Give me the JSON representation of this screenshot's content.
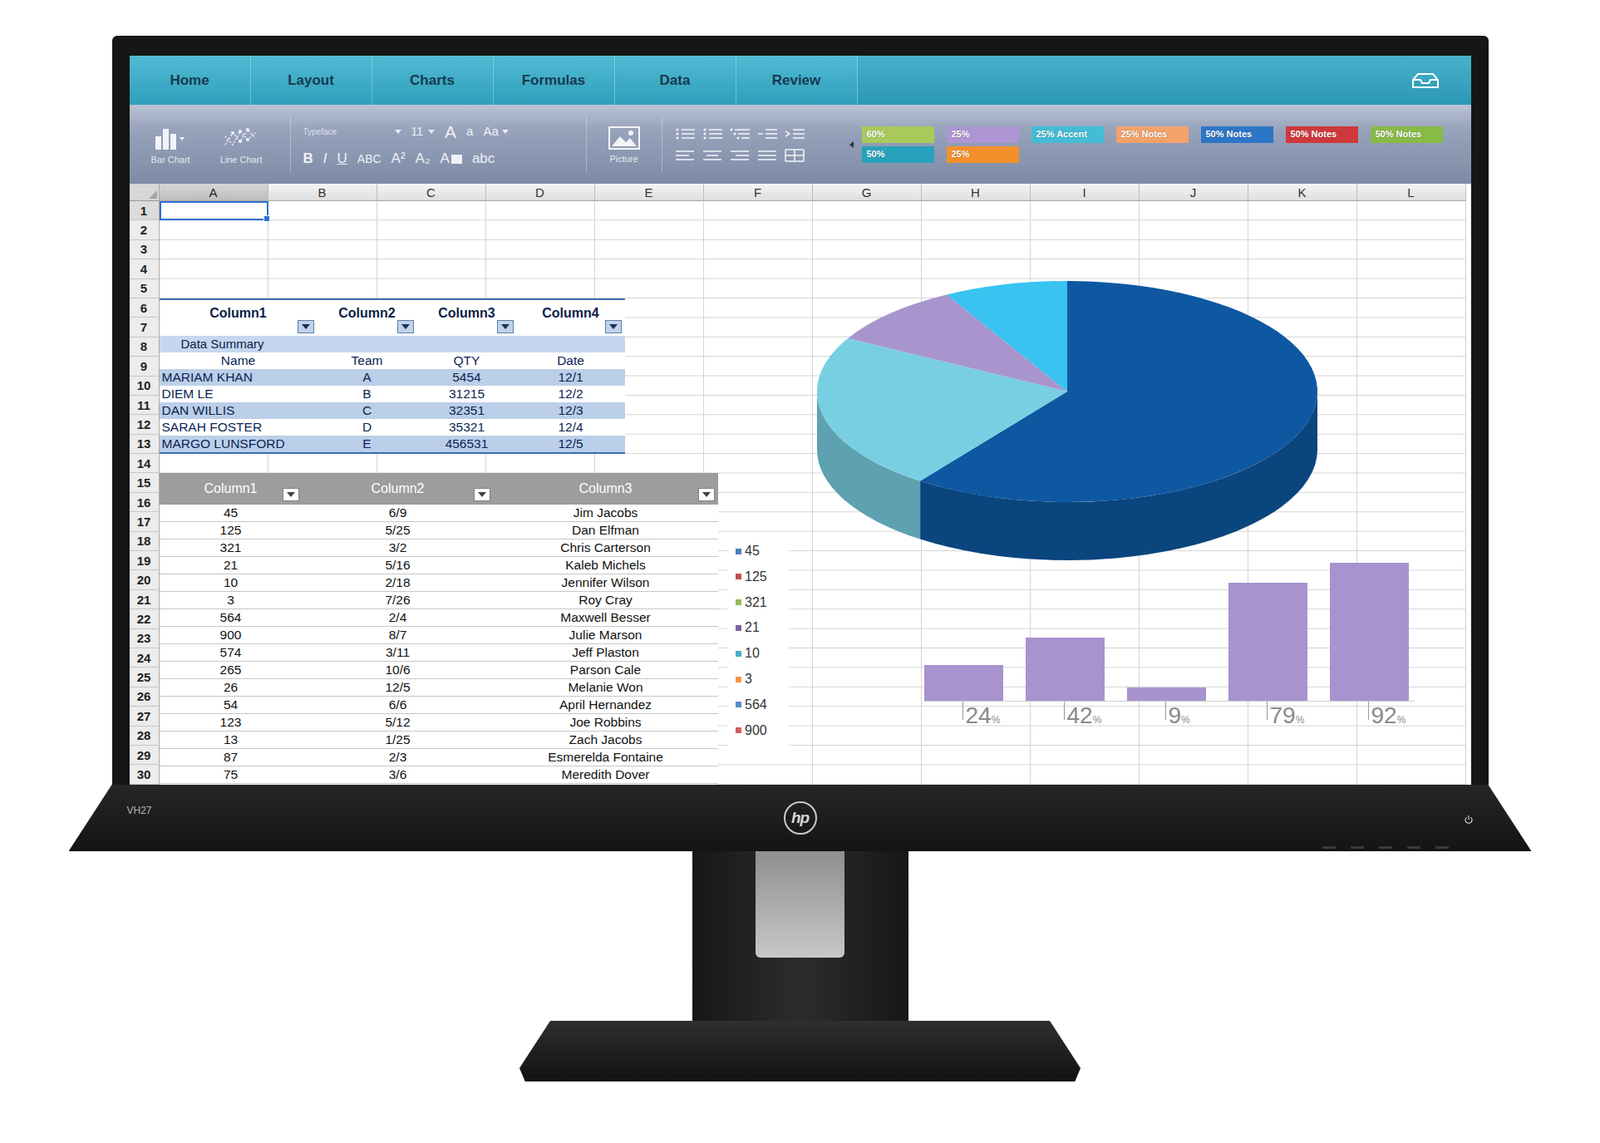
{
  "monitor": {
    "model": "VH27",
    "logo": "hp"
  },
  "ribbon": {
    "tabs": [
      {
        "label": "Home",
        "selected": false
      },
      {
        "label": "Layout",
        "selected": false
      },
      {
        "label": "Charts",
        "selected": false
      },
      {
        "label": "Formulas",
        "selected": false
      },
      {
        "label": "Data",
        "selected": false
      },
      {
        "label": "Review",
        "selected": false
      }
    ]
  },
  "toolbar": {
    "chart_buttons": [
      {
        "label": "Bar Chart",
        "kind": "bar"
      },
      {
        "label": "Line Chart",
        "kind": "line"
      }
    ],
    "typeface": "Typeface",
    "font_size": "11",
    "grow": "A",
    "shrink": "a",
    "change_case": "Aa",
    "format_buttons": [
      "B",
      "I",
      "U",
      "ABC",
      "A²",
      "A₂"
    ],
    "highlight": "A",
    "text_effects": "abc",
    "picture": "Picture",
    "style_rows": [
      [
        {
          "label": "60%",
          "color": "#a9c95c"
        },
        {
          "label": "25%",
          "color": "#ad96d3"
        },
        {
          "label": "25% Accent",
          "color": "#43bdd5"
        },
        {
          "label": "25% Notes",
          "color": "#f3a26b"
        },
        {
          "label": "50% Notes",
          "color": "#2b76c7"
        },
        {
          "label": "50% Notes",
          "color": "#cf383b"
        },
        {
          "label": "50% Notes",
          "color": "#88bb45"
        }
      ],
      [
        {
          "label": "50%",
          "color": "#28a2bc"
        },
        {
          "label": "25%",
          "color": "#f3902c"
        }
      ]
    ]
  },
  "sheet": {
    "columns": [
      {
        "label": "A",
        "selected": true
      },
      {
        "label": "B",
        "selected": false
      },
      {
        "label": "C",
        "selected": false
      },
      {
        "label": "D",
        "selected": false
      },
      {
        "label": "E",
        "selected": false
      },
      {
        "label": "F",
        "selected": false
      },
      {
        "label": "G",
        "selected": false
      },
      {
        "label": "H",
        "selected": false
      },
      {
        "label": "I",
        "selected": false
      },
      {
        "label": "J",
        "selected": false
      },
      {
        "label": "K",
        "selected": false
      },
      {
        "label": "L",
        "selected": false
      }
    ],
    "rows": [
      {
        "label": "1",
        "selected": true
      },
      {
        "label": "2",
        "selected": false
      },
      {
        "label": "3",
        "selected": false
      },
      {
        "label": "4",
        "selected": false
      },
      {
        "label": "5",
        "selected": false
      },
      {
        "label": "6",
        "selected": false
      },
      {
        "label": "7",
        "selected": false
      },
      {
        "label": "8",
        "selected": false
      },
      {
        "label": "9",
        "selected": false
      },
      {
        "label": "10",
        "selected": false
      },
      {
        "label": "11",
        "selected": false
      },
      {
        "label": "12",
        "selected": false
      },
      {
        "label": "13",
        "selected": false
      },
      {
        "label": "14",
        "selected": false
      },
      {
        "label": "15",
        "selected": false
      },
      {
        "label": "16",
        "selected": false
      },
      {
        "label": "17",
        "selected": false
      },
      {
        "label": "18",
        "selected": false
      },
      {
        "label": "19",
        "selected": false
      },
      {
        "label": "20",
        "selected": false
      },
      {
        "label": "21",
        "selected": false
      },
      {
        "label": "22",
        "selected": false
      },
      {
        "label": "23",
        "selected": false
      },
      {
        "label": "24",
        "selected": false
      },
      {
        "label": "25",
        "selected": false
      },
      {
        "label": "26",
        "selected": false
      },
      {
        "label": "27",
        "selected": false
      },
      {
        "label": "28",
        "selected": false
      },
      {
        "label": "29",
        "selected": false
      },
      {
        "label": "30",
        "selected": false
      }
    ]
  },
  "summary_table": {
    "columns": [
      "Column1",
      "Column2",
      "Column3",
      "Column4"
    ],
    "caption": "Data Summary",
    "fields": [
      "Name",
      "Team",
      "QTY",
      "Date"
    ],
    "rows": [
      [
        "MARIAM KHAN",
        "A",
        "5454",
        "12/1"
      ],
      [
        "DIEM LE",
        "B",
        "31215",
        "12/2"
      ],
      [
        "DAN WILLIS",
        "C",
        "32351",
        "12/3"
      ],
      [
        "SARAH FOSTER",
        "D",
        "35321",
        "12/4"
      ],
      [
        "MARGO LUNSFORD",
        "E",
        "456531",
        "12/5"
      ]
    ]
  },
  "list_table": {
    "columns": [
      "Column1",
      "Column2",
      "Column3"
    ],
    "rows": [
      [
        "45",
        "6/9",
        "Jim Jacobs"
      ],
      [
        "125",
        "5/25",
        "Dan Elfman"
      ],
      [
        "321",
        "3/2",
        "Chris Carterson"
      ],
      [
        "21",
        "5/16",
        "Kaleb Michels"
      ],
      [
        "10",
        "2/18",
        "Jennifer Wilson"
      ],
      [
        "3",
        "7/26",
        "Roy Cray"
      ],
      [
        "564",
        "2/4",
        "Maxwell Besser"
      ],
      [
        "900",
        "8/7",
        "Julie Marson"
      ],
      [
        "574",
        "3/11",
        "Jeff Plaston"
      ],
      [
        "265",
        "10/6",
        "Parson Cale"
      ],
      [
        "26",
        "12/5",
        "Melanie Won"
      ],
      [
        "54",
        "6/6",
        "April Hernandez"
      ],
      [
        "123",
        "5/12",
        "Joe Robbins"
      ],
      [
        "13",
        "1/25",
        "Zach Jacobs"
      ],
      [
        "87",
        "2/3",
        "Esmerelda Fontaine"
      ],
      [
        "75",
        "3/6",
        "Meredith Dover"
      ]
    ]
  },
  "legend": {
    "items": [
      {
        "label": "45",
        "color": "#4a7ebb"
      },
      {
        "label": "125",
        "color": "#c0504d"
      },
      {
        "label": "321",
        "color": "#9bbb59"
      },
      {
        "label": "21",
        "color": "#8064a2"
      },
      {
        "label": "10",
        "color": "#4bacc6"
      },
      {
        "label": "3",
        "color": "#f79646"
      },
      {
        "label": "564",
        "color": "#5b8ccf"
      },
      {
        "label": "900",
        "color": "#d0605c"
      }
    ]
  },
  "pie_chart": {
    "values": [
      60,
      23,
      9,
      8
    ],
    "colors": [
      "#0e58a2",
      "#78cfe2",
      "#a995cd",
      "#38c3f1"
    ]
  },
  "bar_chart": {
    "values": [
      24,
      42,
      9,
      79,
      92
    ],
    "labels": [
      {
        "value": "24",
        "unit": "%"
      },
      {
        "value": "42",
        "unit": "%"
      },
      {
        "value": "9",
        "unit": "%"
      },
      {
        "value": "79",
        "unit": "%"
      },
      {
        "value": "92",
        "unit": "%"
      }
    ]
  }
}
